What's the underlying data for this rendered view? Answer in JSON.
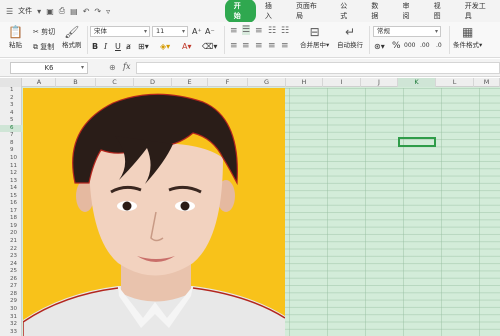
{
  "menu": {
    "hamburger_icon": "menu-icon",
    "file_label": "文件",
    "tabs": [
      {
        "label": "开始",
        "active": true
      },
      {
        "label": "插入"
      },
      {
        "label": "页面布局"
      },
      {
        "label": "公式"
      },
      {
        "label": "数据"
      },
      {
        "label": "审阅"
      },
      {
        "label": "视图"
      },
      {
        "label": "开发工具"
      }
    ],
    "active_color": "#2fa84f"
  },
  "ribbon": {
    "paste": "粘贴",
    "cut": "剪切",
    "copy": "复制",
    "format_painter": "格式刷",
    "font_name": "宋体",
    "font_size": "11",
    "merge_center": "合并居中",
    "wrap_text": "自动换行",
    "number_format": "常规",
    "conditional_format": "条件格式",
    "percent": "%",
    "thousands": "000",
    "inc_decimal": ".00",
    "dec_decimal": ".0"
  },
  "formula_bar": {
    "name_box": "K6",
    "fx": "fx",
    "content": ""
  },
  "sheet": {
    "columns": [
      "A",
      "B",
      "C",
      "D",
      "E",
      "F",
      "G",
      "H",
      "I",
      "J",
      "K",
      "L",
      "M"
    ],
    "rows": [
      "1",
      "2",
      "3",
      "4",
      "5",
      "6",
      "7",
      "8",
      "9",
      "10",
      "11",
      "12",
      "13",
      "14",
      "15",
      "16",
      "17",
      "18",
      "19",
      "20",
      "21",
      "22",
      "23",
      "24",
      "25",
      "26",
      "27",
      "28",
      "29",
      "30",
      "31",
      "32",
      "33"
    ],
    "selected_cell": "K6",
    "background_color": "#d3ecd9",
    "photo_background": "#f8c21a"
  }
}
